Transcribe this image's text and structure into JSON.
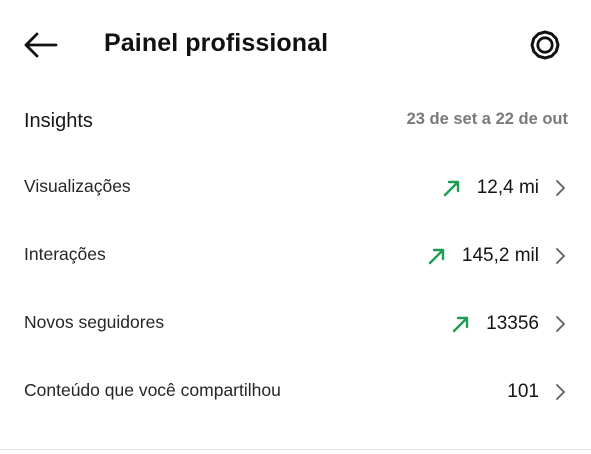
{
  "header": {
    "title": "Painel profissional",
    "back_icon": "arrow-left-icon",
    "settings_icon": "gear-icon"
  },
  "insights": {
    "title": "Insights",
    "date_range": "23 de set a 22 de out"
  },
  "metrics": [
    {
      "label": "Visualizações",
      "value": "12,4 mi",
      "trend": "up"
    },
    {
      "label": "Interações",
      "value": "145,2 mil",
      "trend": "up"
    },
    {
      "label": "Novos seguidores",
      "value": "13356",
      "trend": "up"
    },
    {
      "label": "Conteúdo que você compartilhou",
      "value": "101",
      "trend": "none"
    }
  ],
  "colors": {
    "trend_up": "#1f9d55",
    "text_primary": "#111111",
    "text_secondary": "#7a7a7a",
    "chevron": "#5f5f5f"
  }
}
